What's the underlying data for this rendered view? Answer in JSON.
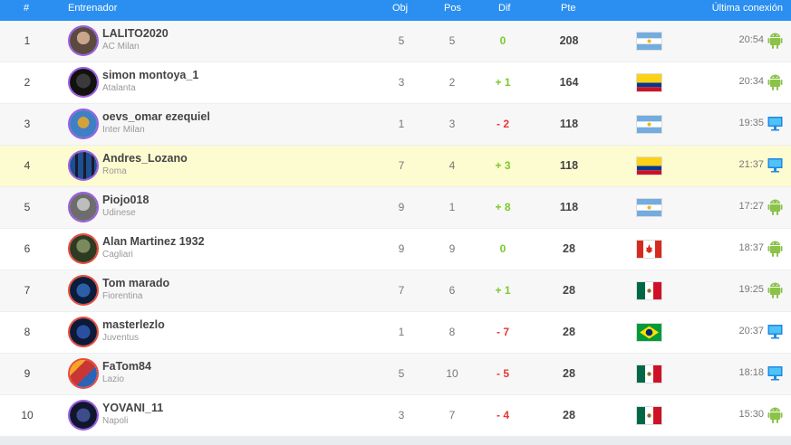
{
  "header": {
    "num": "#",
    "coach": "Entrenador",
    "obj": "Obj",
    "pos": "Pos",
    "dif": "Dif",
    "pte": "Pte",
    "last": "Última conexión"
  },
  "rows": [
    {
      "num": "1",
      "name": "LALITO2020",
      "team": "AC Milan",
      "obj": "5",
      "pos": "5",
      "dif": "0",
      "pte": "208",
      "flag": "argentina",
      "time": "20:54",
      "device": "android-icon"
    },
    {
      "num": "2",
      "name": "simon montoya_1",
      "team": "Atalanta",
      "obj": "3",
      "pos": "2",
      "dif": "+ 1",
      "pte": "164",
      "flag": "colombia",
      "time": "20:34",
      "device": "android-icon"
    },
    {
      "num": "3",
      "name": "oevs_omar ezequiel",
      "team": "Inter Milan",
      "obj": "1",
      "pos": "3",
      "dif": "- 2",
      "pte": "118",
      "flag": "argentina",
      "time": "19:35",
      "device": "desktop-icon"
    },
    {
      "num": "4",
      "name": "Andres_Lozano",
      "team": "Roma",
      "obj": "7",
      "pos": "4",
      "dif": "+ 3",
      "pte": "118",
      "flag": "colombia",
      "time": "21:37",
      "device": "desktop-icon"
    },
    {
      "num": "5",
      "name": "Piojo018",
      "team": "Udinese",
      "obj": "9",
      "pos": "1",
      "dif": "+ 8",
      "pte": "118",
      "flag": "argentina",
      "time": "17:27",
      "device": "android-icon"
    },
    {
      "num": "6",
      "name": "Alan Martinez 1932",
      "team": "Cagliari",
      "obj": "9",
      "pos": "9",
      "dif": "0",
      "pte": "28",
      "flag": "canada",
      "time": "18:37",
      "device": "android-icon"
    },
    {
      "num": "7",
      "name": "Tom marado",
      "team": "Fiorentina",
      "obj": "7",
      "pos": "6",
      "dif": "+ 1",
      "pte": "28",
      "flag": "mexico",
      "time": "19:25",
      "device": "android-icon"
    },
    {
      "num": "8",
      "name": "masterlezlo",
      "team": "Juventus",
      "obj": "1",
      "pos": "8",
      "dif": "- 7",
      "pte": "28",
      "flag": "brazil",
      "time": "20:37",
      "device": "desktop-icon"
    },
    {
      "num": "9",
      "name": "FaTom84",
      "team": "Lazio",
      "obj": "5",
      "pos": "10",
      "dif": "- 5",
      "pte": "28",
      "flag": "mexico",
      "time": "18:18",
      "device": "desktop-icon"
    },
    {
      "num": "10",
      "name": "YOVANI_11",
      "team": "Napoli",
      "obj": "3",
      "pos": "7",
      "dif": "- 4",
      "pte": "28",
      "flag": "mexico",
      "time": "15:30",
      "device": "android-icon"
    }
  ],
  "colors": {
    "header_bg": "#2a8ff0",
    "positive": "#7cc82a",
    "negative": "#e53935",
    "highlight_row": "#fdfbd0"
  }
}
